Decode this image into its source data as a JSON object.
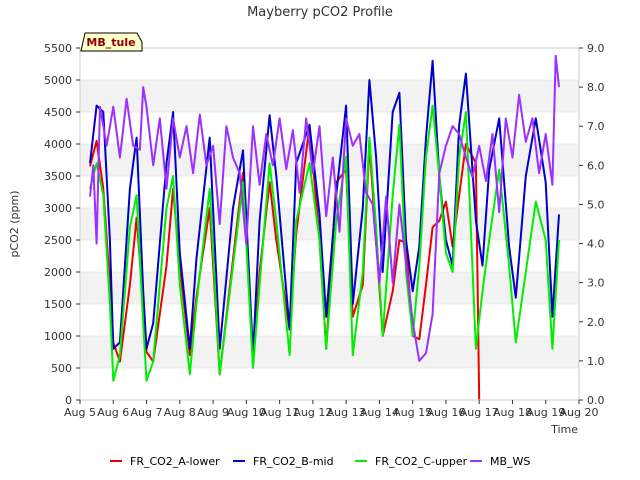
{
  "chart_data": {
    "type": "line",
    "title": "Mayberry pCO2 Profile",
    "xlabel": "Time",
    "ylabel": "pCO2 (ppm)",
    "station_label": "MB_tule",
    "x_ticks": [
      "Aug 5",
      "Aug 6",
      "Aug 7",
      "Aug 8",
      "Aug 9",
      "Aug 10",
      "Aug 11",
      "Aug 12",
      "Aug 13",
      "Aug 14",
      "Aug 15",
      "Aug 16",
      "Aug 17",
      "Aug 18",
      "Aug 19",
      "Aug 20"
    ],
    "xlim": [
      5,
      20
    ],
    "ylim": [
      0,
      5500
    ],
    "y_ticks": [
      0,
      500,
      1000,
      1500,
      2000,
      2500,
      3000,
      3500,
      4000,
      4500,
      5000,
      5500
    ],
    "y2lim": [
      0.0,
      9.0
    ],
    "y2_ticks": [
      "0.0",
      "1.0",
      "2.0",
      "3.0",
      "4.0",
      "5.0",
      "6.0",
      "7.0",
      "8.0",
      "9.0"
    ],
    "grid": "horizontal bands",
    "legend_position": "bottom",
    "series": [
      {
        "name": "FR_CO2_A-lower",
        "color": "#ee0000",
        "axis": "left",
        "x": [
          5.3,
          5.5,
          5.7,
          5.9,
          6.0,
          6.2,
          6.5,
          6.7,
          6.9,
          7.0,
          7.2,
          7.6,
          7.8,
          8.0,
          8.3,
          8.5,
          8.9,
          9.2,
          9.6,
          9.9,
          10.2,
          10.4,
          10.7,
          10.9,
          11.3,
          11.5,
          11.9,
          12.2,
          12.4,
          12.7,
          13.0,
          13.2,
          13.5,
          13.7,
          13.9,
          14.1,
          14.4,
          14.6,
          14.8,
          15.0,
          15.2,
          15.4,
          15.6,
          15.8,
          16.0,
          16.2,
          16.4,
          16.6,
          16.9,
          17.0
        ],
        "y": [
          3650,
          4050,
          3300,
          1800,
          900,
          600,
          1800,
          2850,
          1500,
          750,
          600,
          2100,
          3300,
          2100,
          700,
          1600,
          3000,
          400,
          2200,
          3550,
          550,
          2000,
          3400,
          2500,
          1100,
          2600,
          4300,
          2500,
          800,
          3400,
          3600,
          1300,
          1800,
          4000,
          2500,
          1000,
          1700,
          2500,
          2450,
          1000,
          950,
          1800,
          2700,
          2800,
          3100,
          2400,
          3200,
          4000,
          3700,
          0
        ]
      },
      {
        "name": "FR_CO2_B-mid",
        "color": "#0000cc",
        "axis": "left",
        "x": [
          5.3,
          5.5,
          5.7,
          5.9,
          6.0,
          6.2,
          6.5,
          6.7,
          6.9,
          7.0,
          7.2,
          7.6,
          7.8,
          8.0,
          8.3,
          8.5,
          8.9,
          9.2,
          9.6,
          9.9,
          10.2,
          10.4,
          10.7,
          10.9,
          11.3,
          11.5,
          11.9,
          12.2,
          12.4,
          12.7,
          13.0,
          13.2,
          13.5,
          13.7,
          13.9,
          14.1,
          14.4,
          14.6,
          14.8,
          15.0,
          15.2,
          15.4,
          15.6,
          15.8,
          16.0,
          16.2,
          16.4,
          16.6,
          16.9,
          17.1,
          17.3,
          17.6,
          17.9,
          18.1,
          18.4,
          18.7,
          19.0,
          19.2,
          19.4
        ],
        "y": [
          3700,
          4600,
          4500,
          2500,
          800,
          900,
          3300,
          4100,
          1700,
          800,
          1200,
          3700,
          4500,
          2300,
          800,
          2200,
          4100,
          800,
          3000,
          3900,
          700,
          2800,
          4450,
          3500,
          1100,
          3700,
          4300,
          2900,
          1300,
          3200,
          4600,
          1500,
          3000,
          5000,
          3800,
          2000,
          4500,
          4800,
          2500,
          1700,
          2400,
          4100,
          5300,
          3500,
          2500,
          2100,
          4300,
          5100,
          2800,
          2100,
          3600,
          4400,
          2400,
          1600,
          3500,
          4400,
          3400,
          1300,
          2900
        ]
      },
      {
        "name": "FR_CO2_C-upper",
        "color": "#00ee00",
        "axis": "left",
        "x": [
          5.3,
          5.5,
          5.7,
          5.9,
          6.0,
          6.2,
          6.5,
          6.7,
          6.9,
          7.0,
          7.2,
          7.6,
          7.8,
          8.0,
          8.3,
          8.5,
          8.9,
          9.2,
          9.6,
          9.9,
          10.2,
          10.4,
          10.7,
          10.9,
          11.3,
          11.5,
          11.9,
          12.2,
          12.4,
          12.7,
          13.0,
          13.2,
          13.5,
          13.7,
          13.9,
          14.1,
          14.4,
          14.6,
          14.8,
          15.0,
          15.2,
          15.4,
          15.6,
          15.8,
          16.0,
          16.2,
          16.4,
          16.6,
          16.9,
          17.1,
          17.3,
          17.6,
          17.9,
          18.1,
          18.4,
          18.7,
          19.0,
          19.2,
          19.4
        ],
        "y": [
          3300,
          3700,
          3200,
          1500,
          300,
          700,
          2700,
          3200,
          1200,
          300,
          600,
          3000,
          3500,
          1800,
          400,
          1500,
          3300,
          400,
          2100,
          3400,
          500,
          1800,
          3700,
          2800,
          700,
          2800,
          3700,
          2500,
          800,
          2800,
          3800,
          700,
          2000,
          4100,
          2700,
          1000,
          3200,
          4300,
          2000,
          1000,
          2100,
          3800,
          4600,
          3500,
          2300,
          2000,
          3800,
          4500,
          800,
          1700,
          2500,
          3600,
          2100,
          900,
          2000,
          3100,
          2500,
          800,
          2500
        ]
      },
      {
        "name": "MB_WS",
        "color": "#9b30ff",
        "axis": "right",
        "x": [
          5.3,
          5.4,
          5.5,
          5.6,
          5.8,
          6.0,
          6.2,
          6.4,
          6.6,
          6.8,
          6.9,
          7.0,
          7.2,
          7.4,
          7.6,
          7.8,
          8.0,
          8.2,
          8.4,
          8.6,
          8.8,
          9.0,
          9.2,
          9.4,
          9.6,
          9.8,
          10.0,
          10.2,
          10.4,
          10.6,
          10.8,
          11.0,
          11.2,
          11.4,
          11.6,
          11.8,
          12.0,
          12.2,
          12.4,
          12.6,
          12.8,
          13.0,
          13.2,
          13.4,
          13.6,
          13.8,
          14.0,
          14.2,
          14.4,
          14.6,
          14.8,
          15.0,
          15.2,
          15.4,
          15.6,
          15.8,
          16.0,
          16.2,
          16.4,
          16.6,
          16.8,
          17.0,
          17.2,
          17.4,
          17.6,
          17.8,
          18.0,
          18.2,
          18.4,
          18.6,
          18.8,
          19.0,
          19.2,
          19.3,
          19.4
        ],
        "y": [
          5.2,
          6.0,
          4.0,
          7.5,
          6.5,
          7.5,
          6.2,
          7.7,
          6.5,
          6.4,
          8.0,
          7.5,
          6.0,
          7.2,
          5.4,
          7.2,
          6.2,
          7.0,
          5.8,
          7.3,
          6.0,
          6.5,
          4.5,
          7.0,
          6.2,
          5.8,
          4.0,
          7.0,
          5.5,
          6.8,
          6.0,
          7.2,
          5.9,
          6.9,
          5.3,
          7.2,
          5.8,
          7.0,
          4.7,
          6.2,
          4.3,
          7.2,
          6.5,
          6.8,
          5.3,
          5.0,
          3.0,
          5.2,
          3.0,
          5.0,
          3.5,
          2.0,
          1.0,
          1.2,
          2.2,
          5.8,
          6.5,
          7.0,
          6.8,
          6.2,
          5.7,
          6.5,
          5.6,
          6.8,
          4.8,
          7.2,
          6.2,
          7.8,
          6.6,
          7.2,
          5.8,
          6.8,
          5.5,
          8.8,
          8.0
        ]
      }
    ]
  }
}
